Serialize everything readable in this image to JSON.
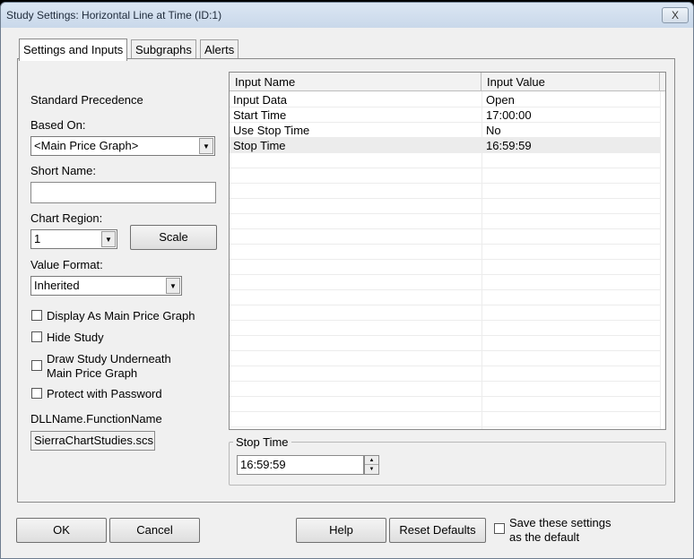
{
  "window": {
    "title": "Study Settings: Horizontal Line at Time (ID:1)",
    "close_label": "X"
  },
  "tabs": [
    {
      "label": "Settings and Inputs",
      "active": true
    },
    {
      "label": "Subgraphs"
    },
    {
      "label": "Alerts"
    }
  ],
  "left": {
    "standard_precedence": "Standard Precedence",
    "based_on_label": "Based On:",
    "based_on_value": "<Main Price Graph>",
    "short_name_label": "Short Name:",
    "short_name_value": "",
    "chart_region_label": "Chart Region:",
    "chart_region_value": "1",
    "scale_button": "Scale",
    "value_format_label": "Value Format:",
    "value_format_value": "Inherited",
    "checkboxes": [
      {
        "label": "Display As Main Price Graph",
        "checked": false
      },
      {
        "label": "Hide Study",
        "checked": false
      },
      {
        "label": "Draw Study Underneath",
        "label2": "Main Price Graph",
        "checked": false
      },
      {
        "label": "Protect with Password",
        "checked": false
      }
    ],
    "dll_label": "DLLName.FunctionName",
    "dll_value": "SierraChartStudies.scs"
  },
  "table": {
    "headers": [
      "Input Name",
      "Input Value"
    ],
    "rows": [
      {
        "name": "Input Data",
        "value": "Open"
      },
      {
        "name": "Start Time",
        "value": "17:00:00"
      },
      {
        "name": "Use Stop Time",
        "value": "No"
      },
      {
        "name": "Stop Time",
        "value": "16:59:59",
        "selected": true
      }
    ]
  },
  "editor": {
    "label": "Stop Time",
    "value": "16:59:59"
  },
  "footer": {
    "ok": "OK",
    "cancel": "Cancel",
    "help": "Help",
    "reset": "Reset Defaults",
    "save_label1": "Save these settings",
    "save_label2": "as the default",
    "save_checked": false
  }
}
